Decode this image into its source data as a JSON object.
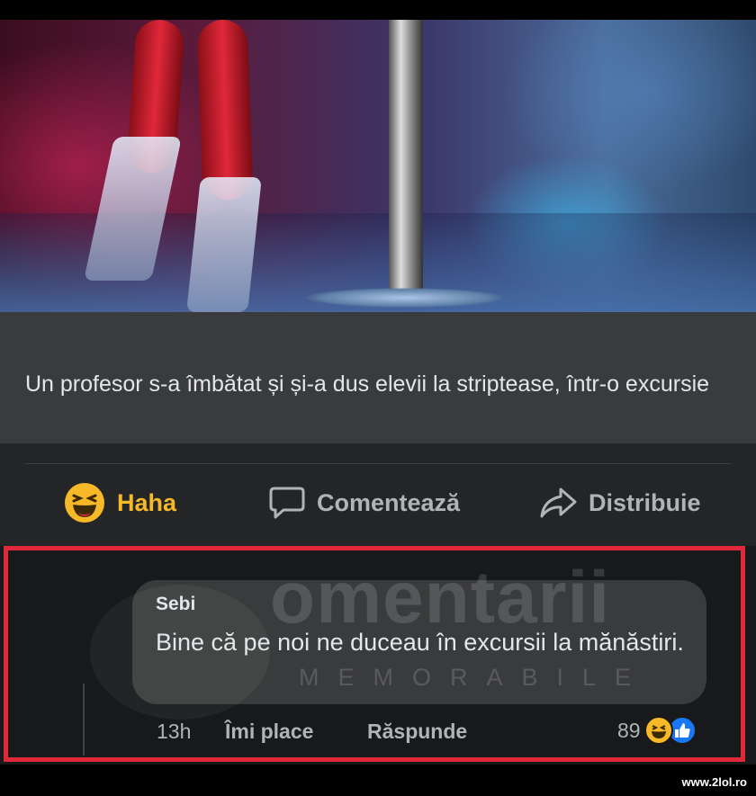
{
  "post": {
    "link_title": "Un profesor s-a îmbătat și și-a dus elevii la striptease, într-o excursie"
  },
  "actions": {
    "reaction_label": "Haha",
    "comment_label": "Comentează",
    "share_label": "Distribuie",
    "reaction_color": "#f7b928"
  },
  "comment": {
    "author": "Sebi",
    "text": "Bine că pe noi ne duceau în excursii la mănăstiri.",
    "time": "13h",
    "like_label": "Îmi place",
    "reply_label": "Răspunde",
    "reaction_count": "89",
    "reaction_icons": [
      "haha-icon",
      "like-icon"
    ]
  },
  "watermark": {
    "main": "omentarii",
    "sub": "MEMORABILE"
  },
  "source_label": "www.2lol.ro",
  "colors": {
    "highlight_border": "#e0283a",
    "like_blue": "#1877f2"
  }
}
